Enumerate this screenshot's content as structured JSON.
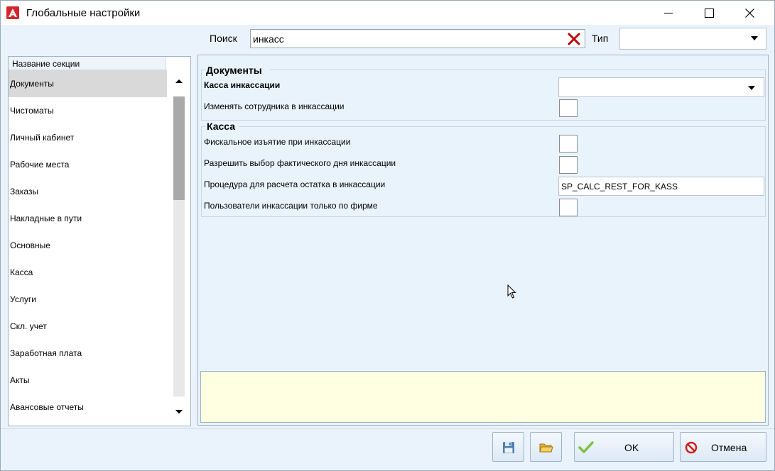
{
  "window": {
    "title": "Глобальные настройки",
    "minimize": "minimize",
    "maximize": "maximize",
    "close": "close"
  },
  "search": {
    "label": "Поиск",
    "value": "инкасс",
    "type_label": "Тип",
    "type_value": ""
  },
  "sections": {
    "header": "Название секции",
    "items": [
      "Документы",
      "Чистоматы",
      "Личный кабинет",
      "Рабочие места",
      "Заказы",
      "Накладные в пути",
      "Основные",
      "Касса",
      "Услуги",
      "Скл. учет",
      "Заработная плата",
      "Акты",
      "Авансовые отчеты"
    ],
    "selected_index": 0
  },
  "groups": {
    "documents": {
      "title": "Документы",
      "kassa_label": "Касса инкассации",
      "kassa_value": "",
      "change_employee_label": "Изменять сотрудника в инкассации",
      "change_employee_checked": false
    },
    "kassa": {
      "title": "Касса",
      "fiscal_label": "Фискальное изъятие при инкассации",
      "fiscal_checked": false,
      "allow_day_label": "Разрешить выбор фактического дня инкассации",
      "allow_day_checked": false,
      "procedure_label": "Процедура для расчета остатка в инкассации",
      "procedure_value": "SP_CALC_REST_FOR_KASS",
      "users_label": "Пользователи инкассации только по фирме",
      "users_checked": false
    }
  },
  "description": "",
  "buttons": {
    "ok": "OK",
    "cancel": "Отмена"
  },
  "colors": {
    "window_bg": "#eaf3fb",
    "description_bg": "#ffffe1",
    "clear_icon": "#c00000",
    "ok_check": "#7cc242",
    "cancel_icon": "#d11f1f",
    "logo": "#d6262d"
  }
}
